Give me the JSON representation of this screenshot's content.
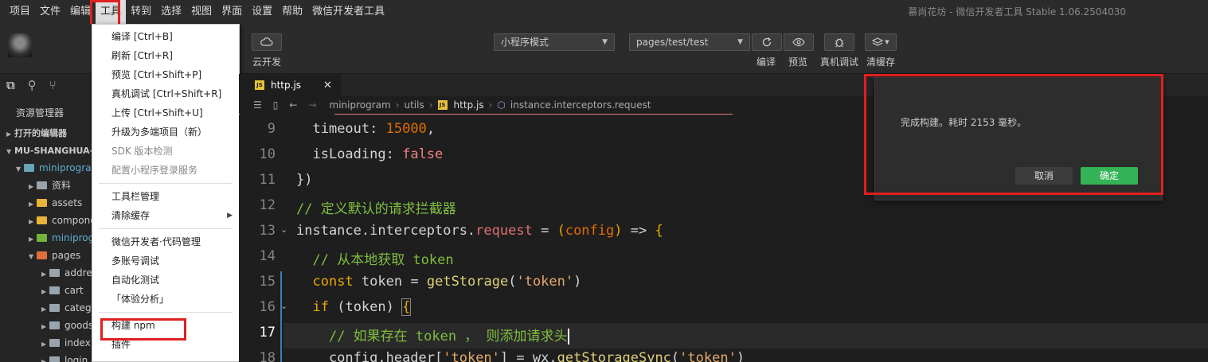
{
  "menubar": {
    "items": [
      "项目",
      "文件",
      "编辑",
      "工具",
      "转到",
      "选择",
      "视图",
      "界面",
      "设置",
      "帮助",
      "微信开发者工具"
    ],
    "active_index": 3,
    "window_title": "慕尚花坊 - 微信开发者工具 Stable 1.06.2504030"
  },
  "toolbar": {
    "cloud_label": "云开发",
    "mode_select": "小程序模式",
    "page_select": "pages/test/test",
    "compile_label": "编译",
    "preview_label": "预览",
    "remote_debug_label": "真机调试",
    "clear_cache_label": "清缓存"
  },
  "sidebar": {
    "title": "资源管理器",
    "open_editors": "打开的编辑器",
    "project": "MU-SHANGHUA-F",
    "tree": [
      {
        "label": "miniprogra",
        "depth": 1,
        "open": true,
        "color": "t",
        "accent": "#5fb0d0"
      },
      {
        "label": "资料",
        "depth": 2,
        "open": false,
        "color": "n"
      },
      {
        "label": "assets",
        "depth": 2,
        "open": false,
        "color": "y"
      },
      {
        "label": "compone",
        "depth": 2,
        "open": false,
        "color": "y"
      },
      {
        "label": "miniprog",
        "depth": 2,
        "open": false,
        "color": "g",
        "accent": "#5fb0d0"
      },
      {
        "label": "pages",
        "depth": 2,
        "open": true,
        "color": "o"
      },
      {
        "label": "address",
        "depth": 3,
        "open": false,
        "color": "n"
      },
      {
        "label": "cart",
        "depth": 3,
        "open": false,
        "color": "n"
      },
      {
        "label": "categor",
        "depth": 3,
        "open": false,
        "color": "n"
      },
      {
        "label": "goods",
        "depth": 3,
        "open": false,
        "color": "n"
      },
      {
        "label": "index",
        "depth": 3,
        "open": false,
        "color": "n"
      },
      {
        "label": "login",
        "depth": 3,
        "open": false,
        "color": "n"
      }
    ]
  },
  "dropdown": {
    "groups": [
      [
        "编译  [Ctrl+B]",
        "刷新  [Ctrl+R]",
        "预览  [Ctrl+Shift+P]",
        "真机调试  [Ctrl+Shift+R]",
        "上传  [Ctrl+Shift+U]",
        "升级为多端项目（新）",
        "SDK 版本检测",
        "配置小程序登录服务"
      ],
      [
        "工具栏管理",
        "清除缓存"
      ],
      [
        "微信开发者·代码管理",
        "多账号调试",
        "自动化测试",
        "「体验分析」"
      ],
      [
        "构建 npm",
        "插件"
      ]
    ],
    "disabled": [
      "SDK 版本检测",
      "配置小程序登录服务"
    ],
    "submenu": [
      "清除缓存"
    ]
  },
  "editor": {
    "tab_name": "http.js",
    "breadcrumb": [
      "miniprogram",
      "utils",
      "http.js",
      "instance.interceptors.request"
    ],
    "line_numbers": [
      "9",
      "10",
      "11",
      "12",
      "13",
      "14",
      "15",
      "16",
      "17",
      "18"
    ],
    "current_line": "17"
  },
  "modal": {
    "message": "完成构建。耗时 2153 毫秒。",
    "cancel": "取消",
    "confirm": "确定"
  },
  "colors": {
    "highlight_red": "#e02020",
    "confirm_green": "#34b356"
  }
}
